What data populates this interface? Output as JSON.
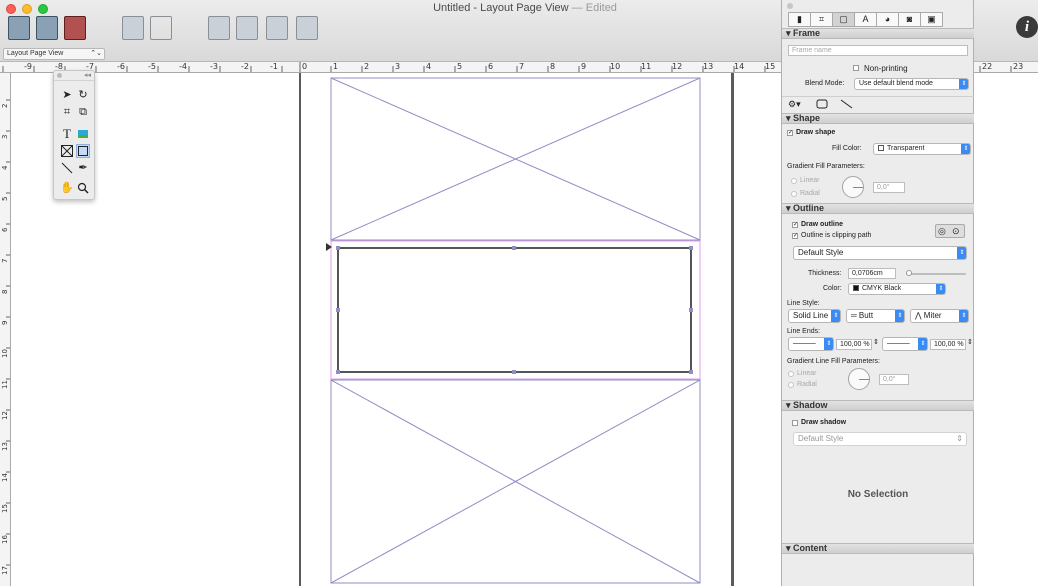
{
  "window": {
    "title": "Untitled - Layout Page View",
    "separator": "—",
    "edited": "Edited"
  },
  "toolbar": {
    "view_select": "Layout Page View"
  },
  "info_button": "i",
  "ruler_h_labels": [
    "-9",
    "-8",
    "-7",
    "-6",
    "-5",
    "-4",
    "-3",
    "-2",
    "-1",
    "0",
    "1",
    "2",
    "3",
    "4",
    "5",
    "6",
    "7",
    "8",
    "9",
    "10",
    "11",
    "12",
    "13",
    "14",
    "15",
    "22",
    "23"
  ],
  "ruler_v_labels": [
    "2",
    "3",
    "4",
    "5",
    "6",
    "7",
    "8",
    "9",
    "10",
    "11",
    "12",
    "13",
    "14",
    "15",
    "16",
    "17"
  ],
  "tool_palette": {
    "text_tool": "T"
  },
  "inspector": {
    "frame": {
      "title": "Frame",
      "name_placeholder": "Frame name",
      "non_printing": "Non-printing",
      "blend_mode_label": "Blend Mode:",
      "blend_mode_value": "Use default blend mode"
    },
    "shape": {
      "title": "Shape",
      "draw_shape": "Draw shape",
      "fill_color_label": "Fill Color:",
      "fill_color_value": "Transparent",
      "gradient_label": "Gradient Fill Parameters:",
      "linear": "Linear",
      "radial": "Radial",
      "angle": "0,0°"
    },
    "outline": {
      "title": "Outline",
      "draw_outline": "Draw outline",
      "clipping_path": "Outline is clipping path",
      "style": "Default Style",
      "thickness_label": "Thickness:",
      "thickness_value": "0,0706cm",
      "color_label": "Color:",
      "color_value": "CMYK Black",
      "line_style_label": "Line Style:",
      "line_style_value": "Solid Line",
      "cap_value": "Butt",
      "join_value": "Miter",
      "line_ends_label": "Line Ends:",
      "start_scale": "100,00 %",
      "end_scale": "100,00 %",
      "gradient_line_label": "Gradient Line Fill Parameters:",
      "linear": "Linear",
      "radial": "Radial",
      "angle": "0,0°"
    },
    "shadow": {
      "title": "Shadow",
      "draw_shadow": "Draw shadow",
      "style": "Default Style"
    },
    "no_selection": "No Selection",
    "content": {
      "title": "Content"
    }
  },
  "colors": {
    "accent": "#3b8bf4",
    "frame_lines": "#8f8fc4",
    "selection": "#e59be8"
  }
}
